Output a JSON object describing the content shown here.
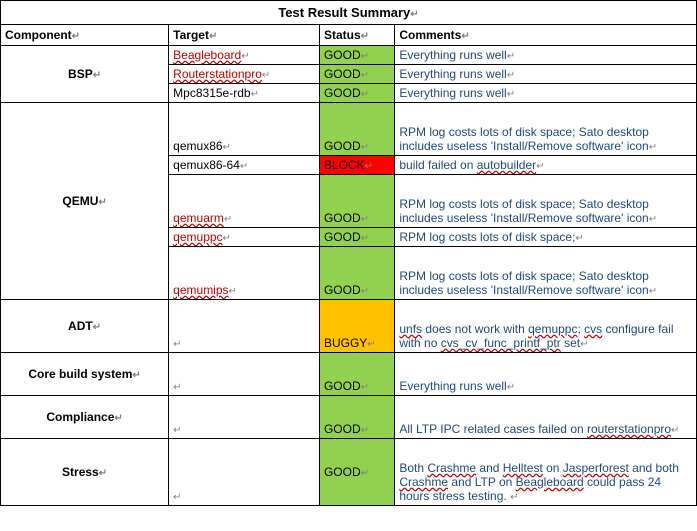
{
  "title": "Test Result Summary",
  "headers": {
    "component": "Component",
    "target": "Target",
    "status": "Status",
    "comments": "Comments"
  },
  "components": {
    "bsp": "BSP",
    "qemu": "QEMU",
    "adt": "ADT",
    "core": "Core build system",
    "compliance": "Compliance",
    "stress": "Stress"
  },
  "rows": {
    "bsp1": {
      "target": "Beagleboard",
      "status": "GOOD",
      "comments": "Everything runs well"
    },
    "bsp2": {
      "target": "Routerstationpro",
      "status": "GOOD",
      "comments": "Everything runs well"
    },
    "bsp3": {
      "target": "Mpc8315e-rdb",
      "status": "GOOD",
      "comments": "Everything runs well"
    },
    "qemu1": {
      "target": "qemux86",
      "status": "GOOD"
    },
    "qemu2": {
      "target": "qemux86-64",
      "status": "BLOCK"
    },
    "qemu3": {
      "target": "qemuarm",
      "status": "GOOD"
    },
    "qemu4": {
      "target": "qemuppc",
      "status": "GOOD"
    },
    "qemu5": {
      "target": "qemumips",
      "status": "GOOD"
    },
    "adt1": {
      "status": "BUGGY"
    },
    "core1": {
      "status": "GOOD",
      "comments": "Everything runs well"
    },
    "comp1": {
      "status": "GOOD"
    },
    "stress1": {
      "status": "GOOD"
    }
  },
  "chart_data": {
    "type": "table",
    "title": "Test Result Summary",
    "columns": [
      "Component",
      "Target",
      "Status",
      "Comments"
    ],
    "rows": [
      [
        "BSP",
        "Beagleboard",
        "GOOD",
        "Everything runs well"
      ],
      [
        "BSP",
        "Routerstationpro",
        "GOOD",
        "Everything runs well"
      ],
      [
        "BSP",
        "Mpc8315e-rdb",
        "GOOD",
        "Everything runs well"
      ],
      [
        "QEMU",
        "qemux86",
        "GOOD",
        "RPM log costs lots of disk space; Sato desktop includes useless 'Install/Remove software' icon"
      ],
      [
        "QEMU",
        "qemux86-64",
        "BLOCK",
        "build failed on autobuilder"
      ],
      [
        "QEMU",
        "qemuarm",
        "GOOD",
        "RPM log costs lots of disk space; Sato desktop includes useless 'Install/Remove software' icon"
      ],
      [
        "QEMU",
        "qemuppc",
        "GOOD",
        "RPM log costs lots of disk space;"
      ],
      [
        "QEMU",
        "qemumips",
        "GOOD",
        "RPM log costs lots of disk space; Sato desktop includes useless 'Install/Remove software' icon"
      ],
      [
        "ADT",
        "",
        "BUGGY",
        "unfs does not work with qemuppc; cvs configure fail with no cvs_cv_func_printf_ptr set"
      ],
      [
        "Core build system",
        "",
        "GOOD",
        "Everything runs well"
      ],
      [
        "Compliance",
        "",
        "GOOD",
        "All LTP IPC related cases failed on routerstationpro"
      ],
      [
        "Stress",
        "",
        "GOOD",
        "Both Crashme and Helltest on Jasperforest and both Crashme and LTP on Beagleboard could pass 24 hours stress testing."
      ]
    ]
  }
}
